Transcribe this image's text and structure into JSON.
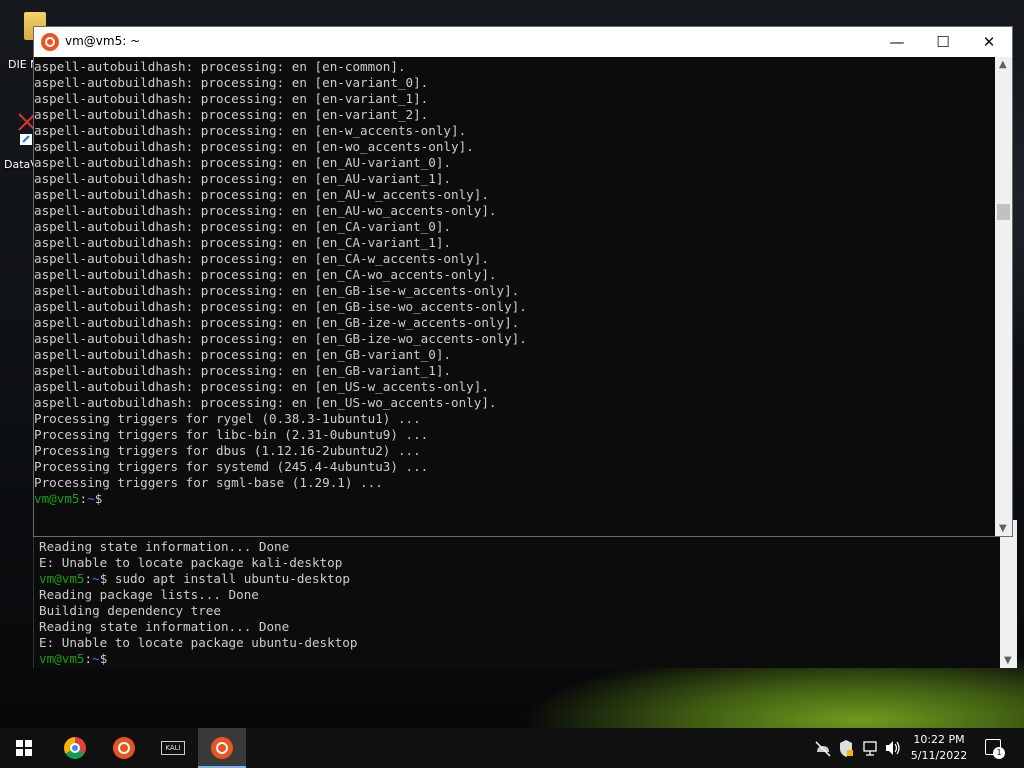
{
  "desktop": {
    "icons": [
      {
        "label": "DIE N",
        "icon": "folder-icon"
      },
      {
        "label": "DataV",
        "icon": "app-shortcut-icon"
      }
    ]
  },
  "window": {
    "title": "vm@vm5: ~",
    "buttons": {
      "minimize": "—",
      "maximize": "☐",
      "close": "✕"
    },
    "lines": [
      {
        "text": "aspell-autobuildhash: processing: en [en-common]."
      },
      {
        "text": "aspell-autobuildhash: processing: en [en-variant_0]."
      },
      {
        "text": "aspell-autobuildhash: processing: en [en-variant_1]."
      },
      {
        "text": "aspell-autobuildhash: processing: en [en-variant_2]."
      },
      {
        "text": "aspell-autobuildhash: processing: en [en-w_accents-only]."
      },
      {
        "text": "aspell-autobuildhash: processing: en [en-wo_accents-only]."
      },
      {
        "text": "aspell-autobuildhash: processing: en [en_AU-variant_0]."
      },
      {
        "text": "aspell-autobuildhash: processing: en [en_AU-variant_1]."
      },
      {
        "text": "aspell-autobuildhash: processing: en [en_AU-w_accents-only]."
      },
      {
        "text": "aspell-autobuildhash: processing: en [en_AU-wo_accents-only]."
      },
      {
        "text": "aspell-autobuildhash: processing: en [en_CA-variant_0]."
      },
      {
        "text": "aspell-autobuildhash: processing: en [en_CA-variant_1]."
      },
      {
        "text": "aspell-autobuildhash: processing: en [en_CA-w_accents-only]."
      },
      {
        "text": "aspell-autobuildhash: processing: en [en_CA-wo_accents-only]."
      },
      {
        "text": "aspell-autobuildhash: processing: en [en_GB-ise-w_accents-only]."
      },
      {
        "text": "aspell-autobuildhash: processing: en [en_GB-ise-wo_accents-only]."
      },
      {
        "text": "aspell-autobuildhash: processing: en [en_GB-ize-w_accents-only]."
      },
      {
        "text": "aspell-autobuildhash: processing: en [en_GB-ize-wo_accents-only]."
      },
      {
        "text": "aspell-autobuildhash: processing: en [en_GB-variant_0]."
      },
      {
        "text": "aspell-autobuildhash: processing: en [en_GB-variant_1]."
      },
      {
        "text": "aspell-autobuildhash: processing: en [en_US-w_accents-only]."
      },
      {
        "text": "aspell-autobuildhash: processing: en [en_US-wo_accents-only]."
      },
      {
        "text": "Processing triggers for rygel (0.38.3-1ubuntu1) ..."
      },
      {
        "text": "Processing triggers for libc-bin (2.31-0ubuntu9) ..."
      },
      {
        "text": "Processing triggers for dbus (1.12.16-2ubuntu2) ..."
      },
      {
        "text": "Processing triggers for systemd (245.4-4ubuntu3) ..."
      },
      {
        "text": "Processing triggers for sgml-base (1.29.1) ..."
      }
    ],
    "prompt": {
      "user": "vm@vm5",
      "sep": ":",
      "path": "~",
      "symbol": "$",
      "command": ""
    }
  },
  "background_terminal": {
    "lines": [
      {
        "text": "Reading state information... Done"
      },
      {
        "text": "E: Unable to locate package kali-desktop"
      },
      {
        "prompt": true,
        "user": "vm@vm5",
        "sep": ":",
        "path": "~",
        "symbol": "$",
        "command": " sudo apt install ubuntu-desktop"
      },
      {
        "text": "Reading package lists... Done"
      },
      {
        "text": "Building dependency tree"
      },
      {
        "text": "Reading state information... Done"
      },
      {
        "text": "E: Unable to locate package ubuntu-desktop"
      },
      {
        "prompt": true,
        "user": "vm@vm5",
        "sep": ":",
        "path": "~",
        "symbol": "$",
        "command": ""
      }
    ]
  },
  "taskbar": {
    "apps": [
      {
        "name": "start-button",
        "icon": "windows-icon"
      },
      {
        "name": "chrome",
        "icon": "chrome-icon"
      },
      {
        "name": "ubuntu",
        "icon": "ubuntu-icon"
      },
      {
        "name": "kali",
        "icon": "kali-icon",
        "label": "KALI"
      },
      {
        "name": "ubuntu-terminal",
        "icon": "ubuntu-icon",
        "active": true
      }
    ],
    "clock": {
      "time": "10:22 PM",
      "date": "5/11/2022"
    },
    "notification_count": "1"
  },
  "colors": {
    "prompt_user": "#13a10e",
    "prompt_path": "#3b78ff",
    "terminal_bg": "#0c0c0c",
    "terminal_fg": "#cccccc",
    "ubuntu_orange": "#e95420"
  }
}
